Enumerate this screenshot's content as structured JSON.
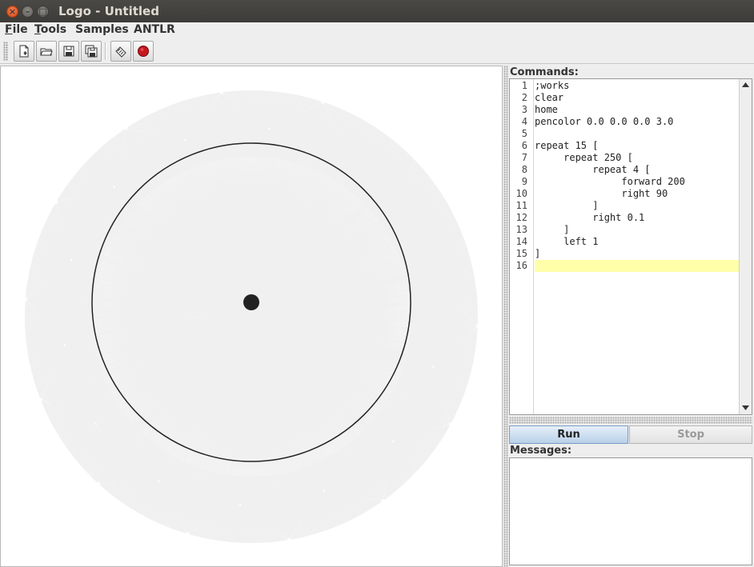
{
  "window": {
    "title": "Logo - Untitled"
  },
  "menubar": {
    "items": [
      {
        "label": "File",
        "mnemonic": "F"
      },
      {
        "label": "Tools",
        "mnemonic": "T"
      },
      {
        "label": "Samples",
        "mnemonic": ""
      },
      {
        "label": "ANTLR",
        "mnemonic": ""
      }
    ]
  },
  "toolbar": {
    "buttons": [
      {
        "icon": "new-file-icon"
      },
      {
        "icon": "open-folder-icon"
      },
      {
        "icon": "save-icon"
      },
      {
        "icon": "save-as-icon"
      },
      {
        "icon": "reformat-icon"
      },
      {
        "icon": "record-icon"
      }
    ]
  },
  "commands": {
    "label": "Commands:",
    "line_numbers": [
      "1",
      "2",
      "3",
      "4",
      "5",
      "6",
      "7",
      "8",
      "9",
      "10",
      "11",
      "12",
      "13",
      "14",
      "15",
      "16"
    ],
    "lines": [
      ";works",
      "clear",
      "home",
      "pencolor 0.0 0.0 0.0 3.0",
      "",
      "repeat 15 [",
      "     repeat 250 [",
      "          repeat 4 [",
      "               forward 200",
      "               right 90",
      "          ]",
      "          right 0.1",
      "     ]",
      "     left 1",
      "]",
      ""
    ],
    "current_line": 16
  },
  "buttons": {
    "run": "Run",
    "stop": "Stop"
  },
  "messages": {
    "label": "Messages:",
    "text": ""
  },
  "colors": {
    "highlight": "#ffffaa",
    "run_accent": "#b9d1ea",
    "close": "#e2571d"
  }
}
